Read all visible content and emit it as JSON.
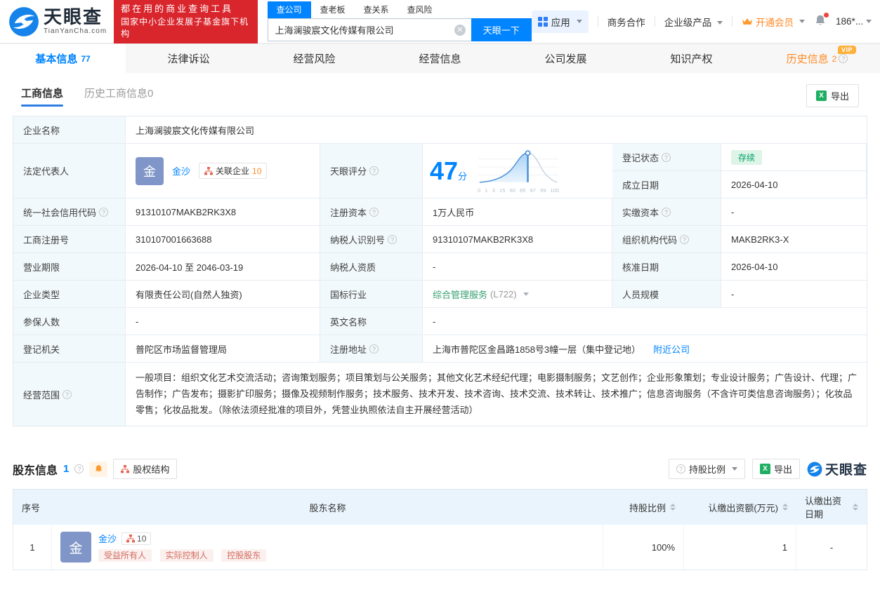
{
  "header": {
    "logo": {
      "title": "天眼查",
      "subtitle": "TianYanCha.com"
    },
    "banner": {
      "line1": "都在用的商业查询工具",
      "line2": "国家中小企业发展子基金旗下机构"
    },
    "search": {
      "tabs": [
        {
          "label": "查公司"
        },
        {
          "label": "查老板"
        },
        {
          "label": "查关系"
        },
        {
          "label": "查风险"
        }
      ],
      "value": "上海澜骏宸文化传媒有限公司",
      "button": "天眼一下"
    },
    "nav": {
      "apps": "应用",
      "biz": "商务合作",
      "enterprise": "企业级产品",
      "vip": "开通会员",
      "user": "186*..."
    }
  },
  "tabs": [
    {
      "label": "基本信息",
      "count": "77"
    },
    {
      "label": "法律诉讼"
    },
    {
      "label": "经营风险"
    },
    {
      "label": "经营信息"
    },
    {
      "label": "公司发展"
    },
    {
      "label": "知识产权"
    },
    {
      "label": "历史信息",
      "count": "2",
      "vip": "VIP"
    }
  ],
  "subtabs": {
    "current": "工商信息",
    "history": "历史工商信息0",
    "export": "导出"
  },
  "info": {
    "company_name_label": "企业名称",
    "company_name": "上海澜骏宸文化传媒有限公司",
    "legal_rep_label": "法定代表人",
    "legal_rep_avatar": "金",
    "legal_rep_name": "金沙",
    "related_label": "关联企业",
    "related_count": "10",
    "reg_status_label": "登记状态",
    "reg_status": "存续",
    "establish_label": "成立日期",
    "establish_date": "2026-04-10",
    "score_label": "天眼评分",
    "score_value": "47",
    "score_unit": "分",
    "score_axis": [
      "0",
      "1",
      "3",
      "15",
      "50",
      "85",
      "97",
      "99",
      "100"
    ],
    "credit_code_label": "统一社会信用代码",
    "credit_code": "91310107MAKB2RK3X8",
    "reg_capital_label": "注册资本",
    "reg_capital": "1万人民币",
    "paid_capital_label": "实缴资本",
    "paid_capital": "-",
    "reg_number_label": "工商注册号",
    "reg_number": "310107001663688",
    "taxpayer_id_label": "纳税人识别号",
    "taxpayer_id": "91310107MAKB2RK3X8",
    "org_code_label": "组织机构代码",
    "org_code": "MAKB2RK3-X",
    "term_label": "营业期限",
    "term": "2026-04-10 至 2046-03-19",
    "taxpayer_quality_label": "纳税人资质",
    "taxpayer_quality": "-",
    "approve_date_label": "核准日期",
    "approve_date": "2026-04-10",
    "company_type_label": "企业类型",
    "company_type": "有限责任公司(自然人独资)",
    "industry_label": "国标行业",
    "industry": "综合管理服务",
    "industry_code": "(L722)",
    "staff_size_label": "人员规模",
    "staff_size": "-",
    "insured_label": "参保人数",
    "insured": "-",
    "english_name_label": "英文名称",
    "english_name": "-",
    "reg_authority_label": "登记机关",
    "reg_authority": "普陀区市场监督管理局",
    "address_label": "注册地址",
    "address": "上海市普陀区金昌路1858号3幢一层（集中登记地）",
    "nearby_link": "附近公司",
    "scope_label": "经营范围",
    "scope": "一般项目：组织文化艺术交流活动；咨询策划服务；项目策划与公关服务；其他文化艺术经纪代理；电影摄制服务；文艺创作；企业形象策划；专业设计服务；广告设计、代理；广告制作；广告发布；摄影扩印服务；摄像及视频制作服务；技术服务、技术开发、技术咨询、技术交流、技术转让、技术推广；信息咨询服务（不含许可类信息咨询服务）；化妆品零售；化妆品批发。（除依法须经批准的项目外，凭营业执照依法自主开展经营活动）"
  },
  "shareholders": {
    "title": "股东信息",
    "count": "1",
    "structure_button": "股权结构",
    "ratio_filter": "持股比例",
    "export": "导出",
    "watermark": "天眼查",
    "columns": [
      "序号",
      "股东名称",
      "持股比例",
      "认缴出资额(万元)",
      "认缴出资日期"
    ],
    "rows": [
      {
        "seq": "1",
        "avatar": "金",
        "name": "金沙",
        "badge": "10",
        "tags": [
          "受益所有人",
          "实际控制人",
          "控股股东"
        ],
        "ratio": "100%",
        "amount": "1",
        "date": "-"
      }
    ]
  }
}
